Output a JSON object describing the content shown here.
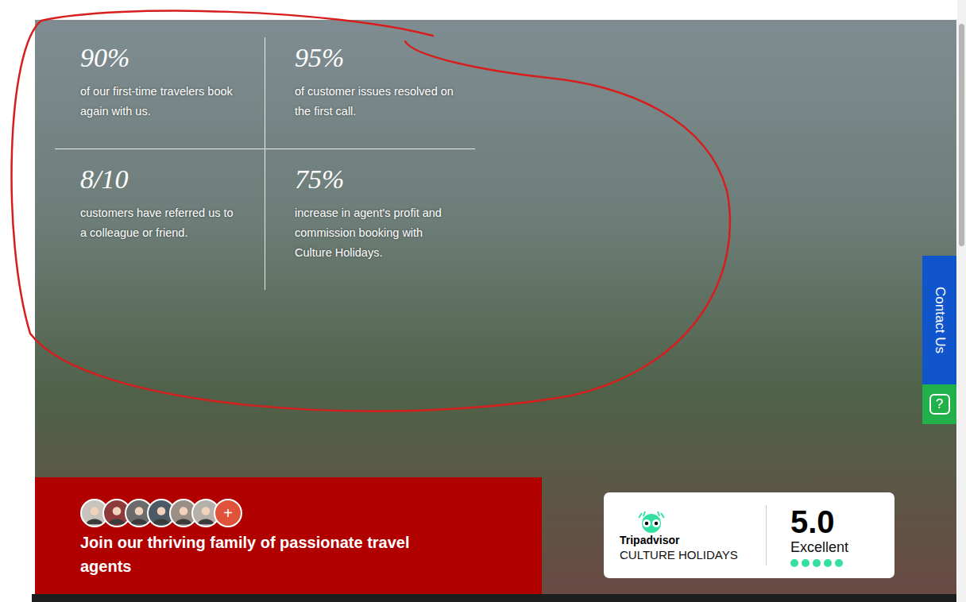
{
  "stats": [
    {
      "value": "90%",
      "text": "of our first-time travelers book again with us."
    },
    {
      "value": "95%",
      "text": "of customer issues resolved on the first call."
    },
    {
      "value": "8/10",
      "text": "customers have referred us to a colleague or friend."
    },
    {
      "value": "75%",
      "text": "increase in agent's profit and commission booking with Culture Holidays."
    }
  ],
  "contact_tab": {
    "label": "Contact Us"
  },
  "help_button": {
    "label": "?"
  },
  "join": {
    "avatars": [
      {
        "color": "#c9c3bd"
      },
      {
        "color": "#8e3a3a"
      },
      {
        "color": "#6b6b6b"
      },
      {
        "color": "#4d5a66"
      },
      {
        "color": "#9a8f84"
      },
      {
        "color": "#b5b0aa"
      }
    ],
    "plus": "+",
    "title": "Join our thriving family of passionate travel agents"
  },
  "tripadvisor": {
    "brand": "Tripadvisor",
    "name": "CULTURE HOLIDAYS",
    "score": "5.0",
    "rating": "Excellent",
    "stars": 5
  }
}
